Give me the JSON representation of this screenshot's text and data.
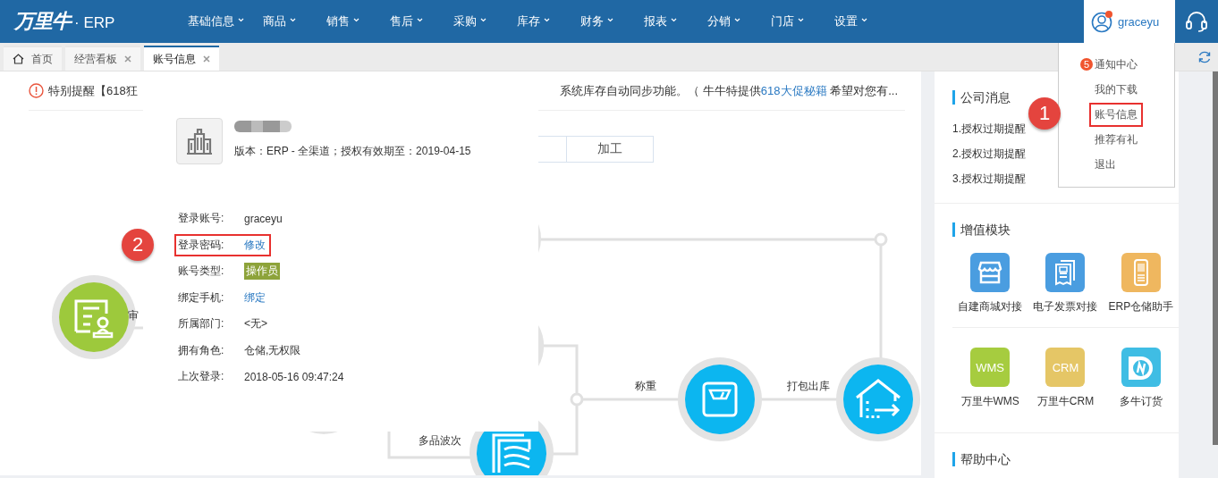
{
  "header": {
    "logo": "万里牛",
    "logo_suffix": "· ERP",
    "nav": [
      {
        "label": "基础信息"
      },
      {
        "label": "商品"
      },
      {
        "label": "销售"
      },
      {
        "label": "售后"
      },
      {
        "label": "采购"
      },
      {
        "label": "库存"
      },
      {
        "label": "财务"
      },
      {
        "label": "报表"
      },
      {
        "label": "分销"
      },
      {
        "label": "门店"
      },
      {
        "label": "设置"
      }
    ],
    "user": {
      "name": "graceyu",
      "has_notification": true
    }
  },
  "tabs": [
    {
      "label": "首页",
      "kind": "home",
      "selected": false
    },
    {
      "label": "经营看板",
      "kind": "closable",
      "selected": false
    },
    {
      "label": "账号信息",
      "kind": "closable",
      "selected": true
    }
  ],
  "notice": {
    "text_start": "特别提醒【618狂",
    "text_end": "系统库存自动同步功能。（ 牛牛特提供",
    "link": "618大促秘籍",
    "text_after": " 希望对您有..."
  },
  "flow": {
    "segments": [
      {
        "label": "加工"
      }
    ],
    "nodes": [
      {
        "kind": "audit",
        "label": "审"
      },
      {
        "kind": "waves",
        "label": "多品波次"
      },
      {
        "kind": "scale",
        "label": "称重"
      },
      {
        "kind": "package",
        "label": "打包出库"
      }
    ]
  },
  "account_popup": {
    "version": "版本：ERP - 全渠道；授权有效期至：2019-04-15",
    "rows": [
      {
        "label": "登录账号:",
        "value": "graceyu",
        "kind": "text",
        "highlighted": false
      },
      {
        "label": "登录密码:",
        "value": "修改",
        "kind": "link",
        "highlighted": true,
        "callout": "2"
      },
      {
        "label": "账号类型:",
        "value": "操作员",
        "kind": "tag",
        "highlighted": false
      },
      {
        "label": "绑定手机:",
        "value": "绑定",
        "kind": "link",
        "highlighted": false
      },
      {
        "label": "所属部门:",
        "value": "<无>",
        "kind": "text",
        "highlighted": false
      },
      {
        "label": "拥有角色:",
        "value": "仓储,无权限",
        "kind": "text",
        "highlighted": false
      },
      {
        "label": "上次登录:",
        "value": "2018-05-16 09:47:24",
        "kind": "text",
        "highlighted": false
      }
    ]
  },
  "company_news": {
    "title": "公司消息",
    "items": [
      "1.授权过期提醒",
      "2.授权过期提醒",
      "3.授权过期提醒"
    ]
  },
  "modules": {
    "title": "增值模块",
    "rows": [
      [
        {
          "label": "自建商城对接",
          "kind": "store",
          "color": "#4a9de0"
        },
        {
          "label": "电子发票对接",
          "kind": "invoice",
          "color": "#4a9de0"
        },
        {
          "label": "ERP仓储助手",
          "kind": "handheld",
          "color": "#efb75f"
        }
      ],
      [
        {
          "label": "万里牛WMS",
          "kind": "text",
          "icon_text": "WMS",
          "color": "#a6cc3f"
        },
        {
          "label": "万里牛CRM",
          "kind": "text",
          "icon_text": "CRM",
          "color": "#e5c666"
        },
        {
          "label": "多牛订货",
          "kind": "order",
          "color": "#3fbde4"
        }
      ]
    ]
  },
  "help": {
    "title": "帮助中心"
  },
  "user_menu": {
    "items": [
      {
        "label": "通知中心",
        "badge": "5",
        "highlighted": false
      },
      {
        "label": "我的下载",
        "highlighted": false
      },
      {
        "label": "账号信息",
        "highlighted": true,
        "callout": "1"
      },
      {
        "label": "推荐有礼",
        "highlighted": false
      },
      {
        "label": "退出",
        "highlighted": false
      }
    ]
  }
}
